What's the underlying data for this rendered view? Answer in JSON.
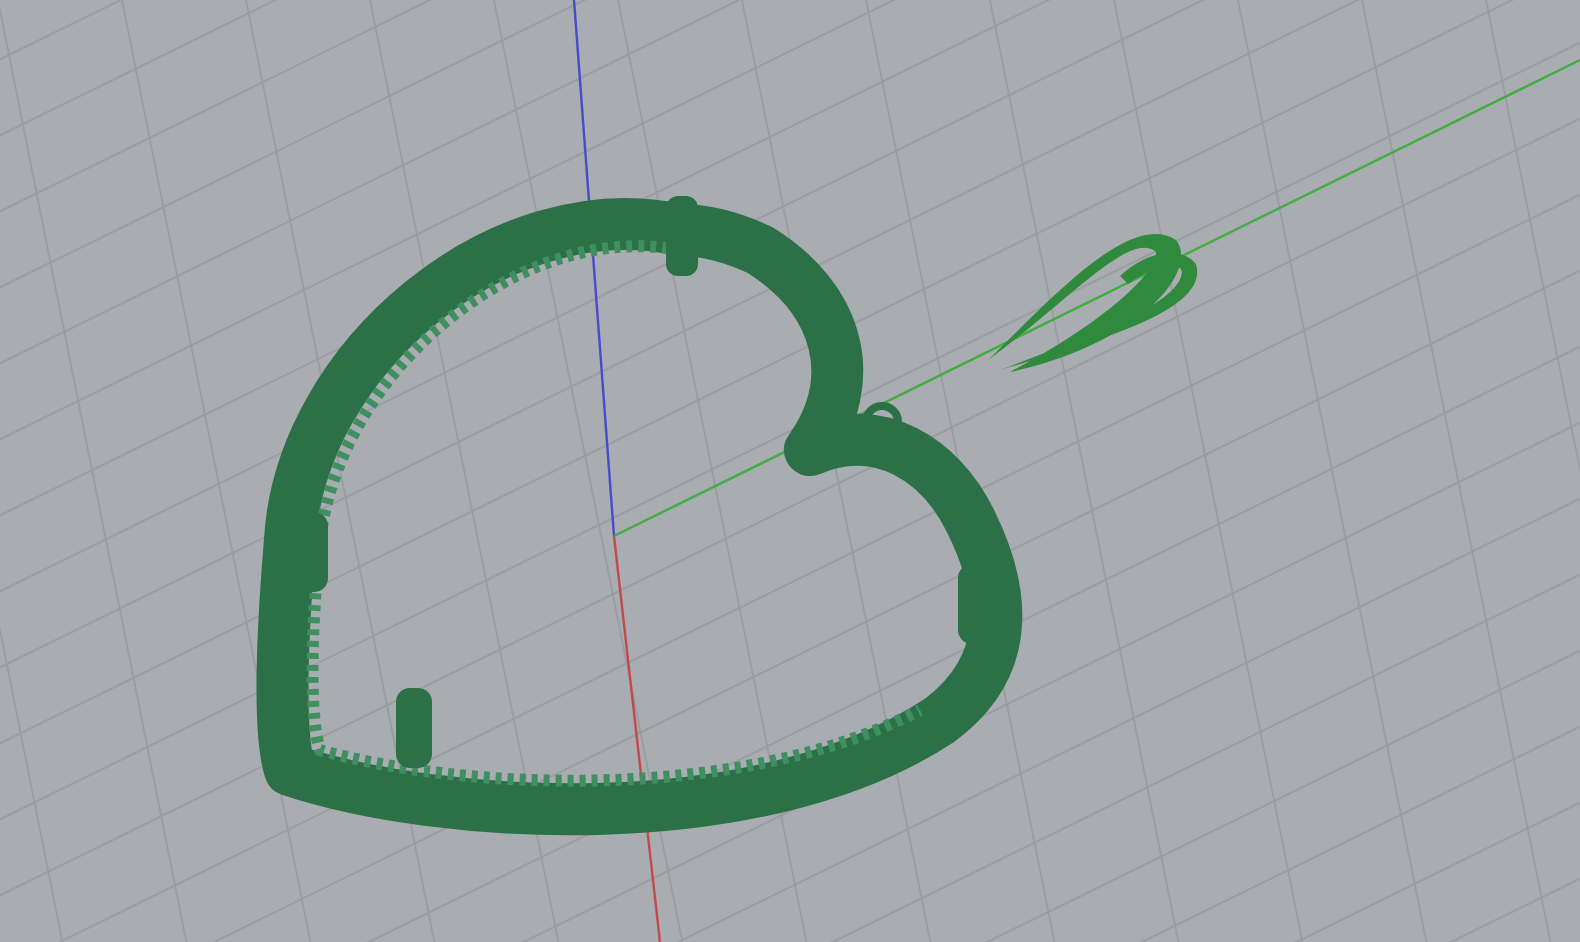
{
  "viewport": {
    "grid": true
  },
  "axes": [
    {
      "kind": "z",
      "color": "#4a4acc"
    },
    {
      "kind": "x",
      "color": "#c24a4a"
    },
    {
      "kind": "y",
      "color": "#3fae3f"
    }
  ]
}
